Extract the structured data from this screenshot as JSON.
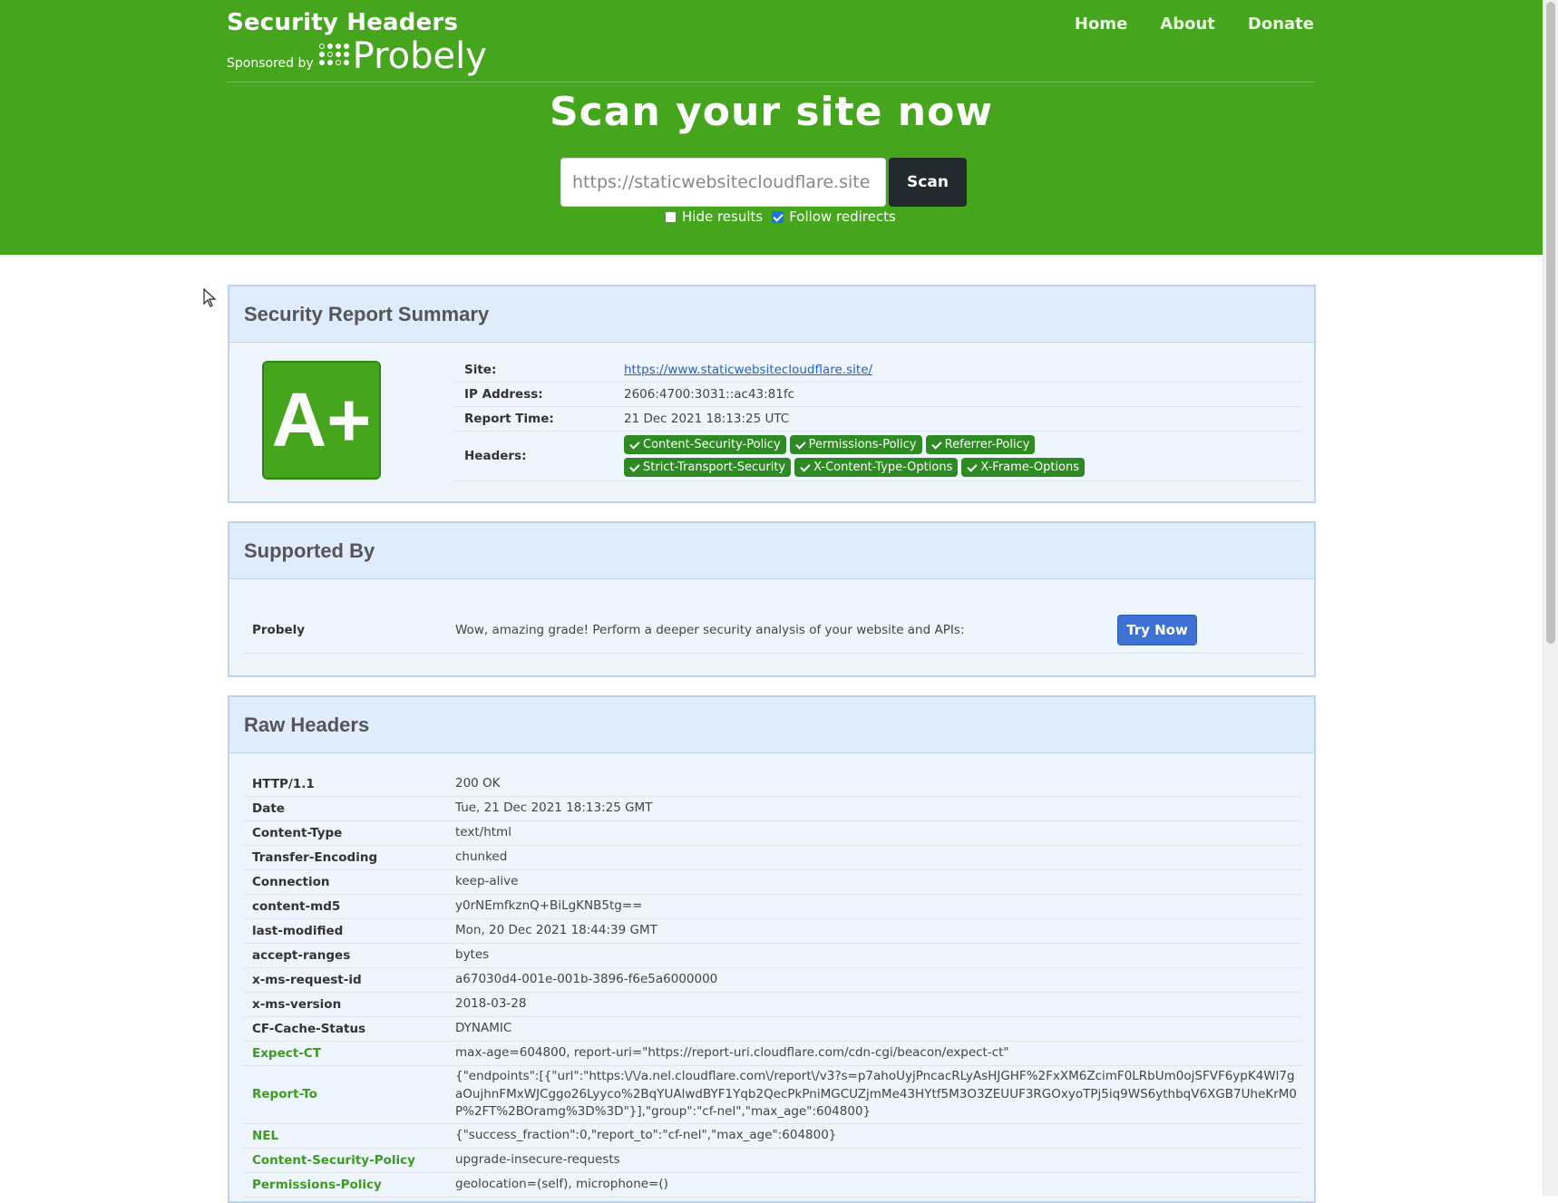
{
  "header": {
    "brand_title": "Security Headers",
    "sponsored_by": "Sponsored by",
    "sponsor_name": "Probely",
    "nav": [
      "Home",
      "About",
      "Donate"
    ],
    "hero_title": "Scan your site now",
    "scan_input_value": "https://staticwebsitecloudflare.site",
    "scan_button": "Scan",
    "options": [
      {
        "label": "Hide results",
        "checked": false
      },
      {
        "label": "Follow redirects",
        "checked": true
      }
    ]
  },
  "summary": {
    "title": "Security Report Summary",
    "grade": "A+",
    "site_label": "Site:",
    "site_value": "https://www.staticwebsitecloudflare.site/",
    "ip_label": "IP Address:",
    "ip_value": "2606:4700:3031::ac43:81fc",
    "time_label": "Report Time:",
    "time_value": "21 Dec 2021 18:13:25 UTC",
    "headers_label": "Headers:",
    "headers": [
      "Content-Security-Policy",
      "Permissions-Policy",
      "Referrer-Policy",
      "Strict-Transport-Security",
      "X-Content-Type-Options",
      "X-Frame-Options"
    ]
  },
  "supported": {
    "title": "Supported By",
    "name": "Probely",
    "text": "Wow, amazing grade! Perform a deeper security analysis of your website and APIs:",
    "button": "Try Now"
  },
  "raw": {
    "title": "Raw Headers",
    "rows": [
      {
        "k": "HTTP/1.1",
        "v": "200 OK",
        "green": false
      },
      {
        "k": "Date",
        "v": "Tue, 21 Dec 2021 18:13:25 GMT",
        "green": false
      },
      {
        "k": "Content-Type",
        "v": "text/html",
        "green": false
      },
      {
        "k": "Transfer-Encoding",
        "v": "chunked",
        "green": false
      },
      {
        "k": "Connection",
        "v": "keep-alive",
        "green": false
      },
      {
        "k": "content-md5",
        "v": "y0rNEmfkznQ+BiLgKNB5tg==",
        "green": false
      },
      {
        "k": "last-modified",
        "v": "Mon, 20 Dec 2021 18:44:39 GMT",
        "green": false
      },
      {
        "k": "accept-ranges",
        "v": "bytes",
        "green": false
      },
      {
        "k": "x-ms-request-id",
        "v": "a67030d4-001e-001b-3896-f6e5a6000000",
        "green": false
      },
      {
        "k": "x-ms-version",
        "v": "2018-03-28",
        "green": false
      },
      {
        "k": "CF-Cache-Status",
        "v": "DYNAMIC",
        "green": false
      },
      {
        "k": "Expect-CT",
        "v": "max-age=604800, report-uri=\"https://report-uri.cloudflare.com/cdn-cgi/beacon/expect-ct\"",
        "green": true
      },
      {
        "k": "Report-To",
        "v": "{\"endpoints\":[{\"url\":\"https:\\/\\/a.nel.cloudflare.com\\/report\\/v3?s=p7ahoUyjPncacRLyAsHJGHF%2FxXM6ZcimF0LRbUm0ojSFVF6ypK4Wl7gaOujhnFMxWJCggo26Lyyco%2BqYUAlwdBYF1Yqb2QecPkPniMGCUZjmMe43HYtf5M3O3ZEUUF3RGOxyoTPj5iq9WS6ythbqV6XGB7UheKrM0P%2FT%2BOramg%3D%3D\"}],\"group\":\"cf-nel\",\"max_age\":604800}",
        "green": true
      },
      {
        "k": "NEL",
        "v": "{\"success_fraction\":0,\"report_to\":\"cf-nel\",\"max_age\":604800}",
        "green": true
      },
      {
        "k": "Content-Security-Policy",
        "v": "upgrade-insecure-requests",
        "green": true
      },
      {
        "k": "Permissions-Policy",
        "v": "geolocation=(self), microphone=()",
        "green": true
      }
    ]
  },
  "colors": {
    "brand_green": "#45a61e",
    "badge_green": "#2e8b23",
    "button_blue": "#3d72d4",
    "box_header": "#deecfb"
  },
  "icons": {
    "check": "check-icon",
    "cursor": "mouse-cursor-icon"
  }
}
